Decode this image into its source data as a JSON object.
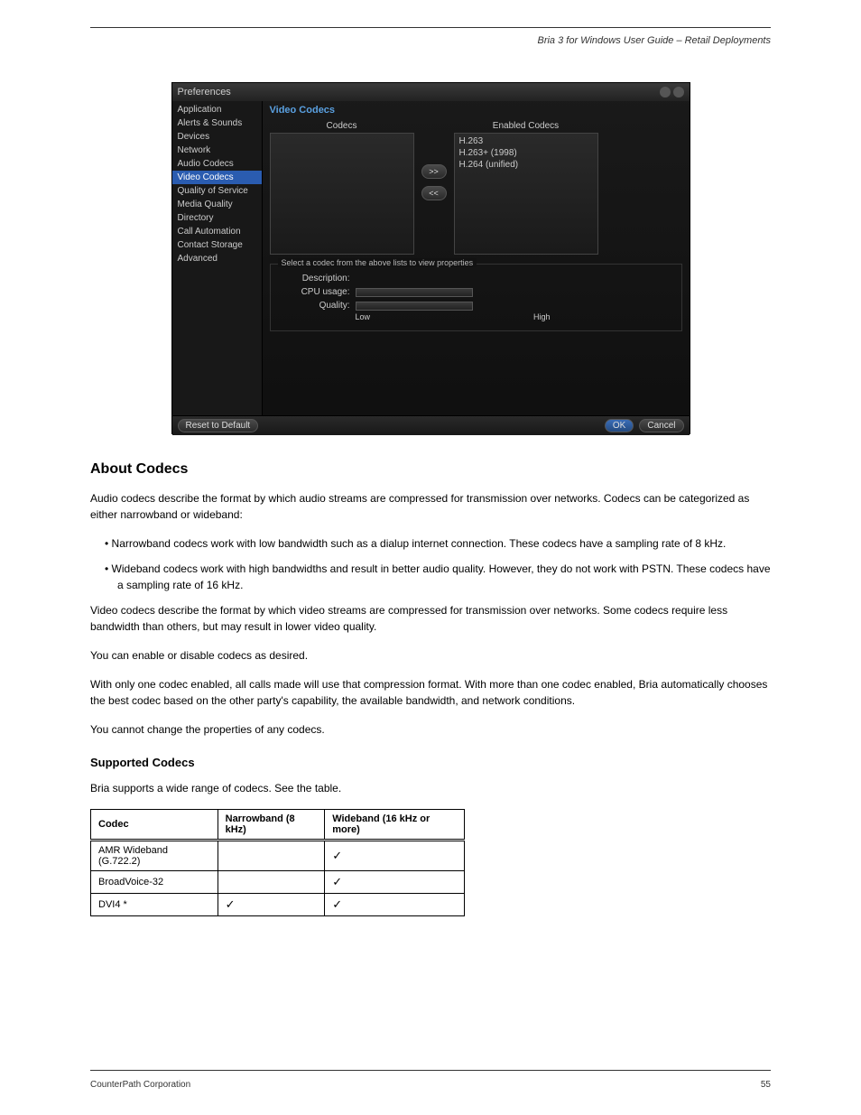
{
  "doc": {
    "header_right": "Bria 3 for Windows User Guide – Retail Deployments",
    "footer_left": "CounterPath Corporation",
    "footer_right": "55"
  },
  "dialog": {
    "title": "Preferences",
    "sidebar": [
      "Application",
      "Alerts & Sounds",
      "Devices",
      "Network",
      "Audio Codecs",
      "Video Codecs",
      "Quality of Service",
      "Media Quality",
      "Directory",
      "Call Automation",
      "Contact Storage",
      "Advanced"
    ],
    "selected_sidebar": "Video Codecs",
    "panel_title": "Video Codecs",
    "codecs_label": "Codecs",
    "enabled_label": "Enabled Codecs",
    "enabled_codecs": [
      "H.263",
      "H.263+ (1998)",
      "H.264 (unified)"
    ],
    "move_right": ">>",
    "move_left": "<<",
    "props_legend": "Select a codec from the above lists to view properties",
    "description_label": "Description:",
    "cpu_label": "CPU usage:",
    "quality_label": "Quality:",
    "low": "Low",
    "high": "High",
    "reset": "Reset to Default",
    "ok": "OK",
    "cancel": "Cancel"
  },
  "text": {
    "h2": "About Codecs",
    "p1": "Audio codecs describe the format by which audio streams are compressed for transmission over networks. Codecs can be categorized as either narrowband or wideband:",
    "b1": "Narrowband codecs work with low bandwidth such as a dialup internet connection. These codecs have a sampling rate of 8 kHz.",
    "b2": "Wideband codecs work with high bandwidths and result in better audio quality. However, they do not work with PSTN. These codecs have a sampling rate of 16 kHz.",
    "p2": "Video codecs describe the format by which video streams are compressed for transmission over networks. Some codecs require less bandwidth than others, but may result in lower video quality.",
    "p3": "You can enable or disable codecs as desired.",
    "p4": "With only one codec enabled, all calls made will use that compression format. With more than one codec enabled, Bria automatically chooses the best codec based on the other party's capability, the available bandwidth, and network conditions.",
    "p5": "You cannot change the properties of any codecs.",
    "h3": "Supported Codecs",
    "p6": "Bria supports a wide range of codecs. See the table.",
    "table": {
      "headers": [
        "Codec",
        "Narrowband (8 kHz)",
        "Wideband (16 kHz or more)"
      ],
      "rows": [
        [
          "AMR Wideband (G.722.2)",
          "",
          "✓"
        ],
        [
          "BroadVoice-32",
          "",
          "✓"
        ],
        [
          "DVI4  *",
          "✓",
          "✓"
        ]
      ]
    }
  }
}
